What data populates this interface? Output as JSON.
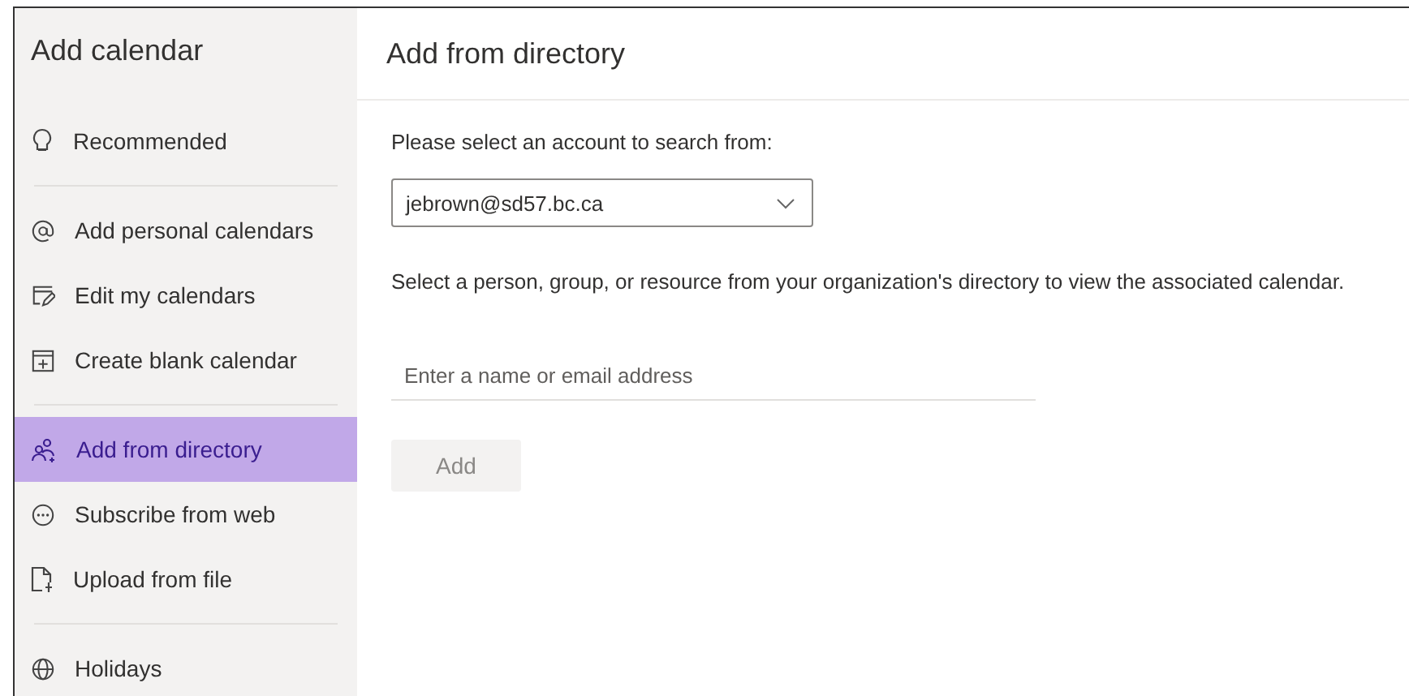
{
  "sidebar": {
    "title": "Add calendar",
    "groups": [
      {
        "items": [
          {
            "label": "Recommended",
            "kind": "bulb",
            "selected": false
          }
        ]
      },
      {
        "items": [
          {
            "label": "Add personal calendars",
            "kind": "at",
            "selected": false
          },
          {
            "label": "Edit my calendars",
            "kind": "edit",
            "selected": false
          },
          {
            "label": "Create blank calendar",
            "kind": "calendar",
            "selected": false
          }
        ]
      },
      {
        "items": [
          {
            "label": "Add from directory",
            "kind": "people",
            "selected": true
          },
          {
            "label": "Subscribe from web",
            "kind": "web",
            "selected": false
          },
          {
            "label": "Upload from file",
            "kind": "file",
            "selected": false
          }
        ]
      },
      {
        "items": [
          {
            "label": "Holidays",
            "kind": "globe",
            "selected": false
          }
        ]
      }
    ]
  },
  "main": {
    "title": "Add from directory",
    "account_label": "Please select an account to search from:",
    "account": {
      "value": "jebrown@sd57.bc.ca"
    },
    "description": "Select a person, group, or resource from your organization's directory to view the associated calendar.",
    "search": {
      "placeholder": "Enter a name or email address"
    },
    "add_button": {
      "label": "Add",
      "disabled": true
    }
  }
}
